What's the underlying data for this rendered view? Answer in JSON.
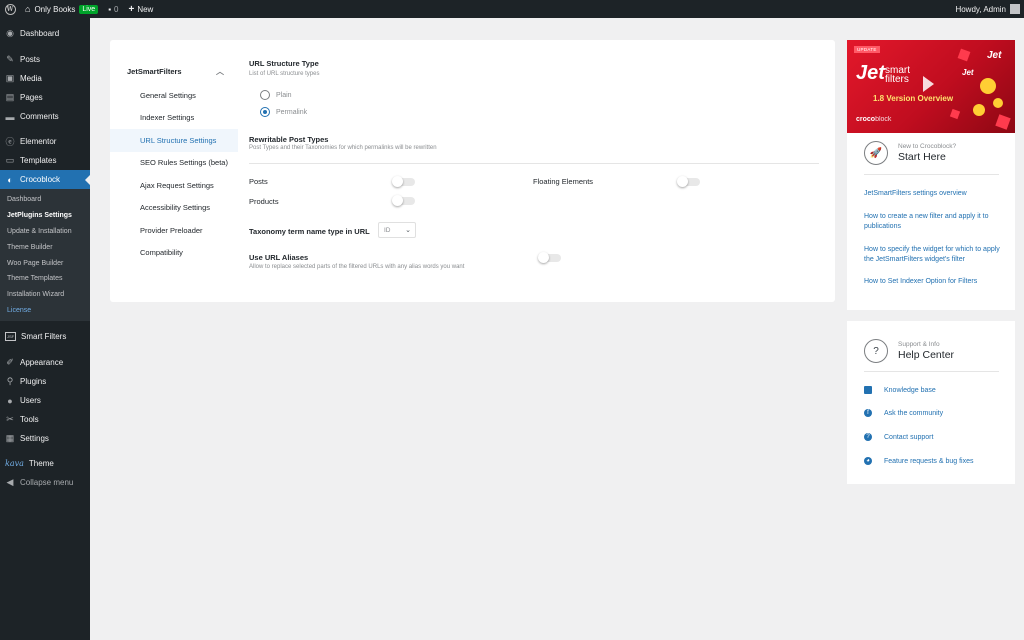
{
  "adminbar": {
    "site_name": "Only Books",
    "live_badge": "Live",
    "comments_count": "0",
    "new_label": "New",
    "greeting": "Howdy, Admin"
  },
  "sidebar": {
    "items_top": [
      {
        "label": "Dashboard",
        "icon": "dashboard-icon"
      },
      {
        "label": "Posts",
        "icon": "pin-icon"
      },
      {
        "label": "Media",
        "icon": "media-icon"
      },
      {
        "label": "Pages",
        "icon": "pages-icon"
      },
      {
        "label": "Comments",
        "icon": "comments-icon"
      },
      {
        "label": "Elementor",
        "icon": "elementor-icon"
      },
      {
        "label": "Templates",
        "icon": "folder-icon"
      },
      {
        "label": "Crocoblock",
        "icon": "crocoblock-icon"
      }
    ],
    "submenu": [
      "Dashboard",
      "JetPlugins Settings",
      "Update & Installation",
      "Theme Builder",
      "Woo Page Builder",
      "Theme Templates",
      "Installation Wizard",
      "License"
    ],
    "smart_filters": "Smart Filters",
    "items_bottom": [
      {
        "label": "Appearance",
        "icon": "appearance-icon"
      },
      {
        "label": "Plugins",
        "icon": "plugins-icon"
      },
      {
        "label": "Users",
        "icon": "users-icon"
      },
      {
        "label": "Tools",
        "icon": "tools-icon"
      },
      {
        "label": "Settings",
        "icon": "settings-icon"
      }
    ],
    "theme_logo": "kava",
    "theme_label": "Theme",
    "collapse_label": "Collapse menu"
  },
  "settings_nav": {
    "title": "JetSmartFilters",
    "items": [
      "General Settings",
      "Indexer Settings",
      "URL Structure Settings",
      "SEO Rules Settings (beta)",
      "Ajax Request Settings",
      "Accessibility Settings",
      "Provider Preloader",
      "Compatibility"
    ],
    "active_index": 2
  },
  "url_structure": {
    "title": "URL Structure Type",
    "desc": "List of URL structure types",
    "options": [
      "Plain",
      "Permalink"
    ],
    "selected": "Permalink"
  },
  "rewritable": {
    "title": "Rewritable Post Types",
    "desc": "Post Types and their Taxonomies for which permalinks will be rewritten",
    "posts_label": "Posts",
    "products_label": "Products",
    "floating_label": "Floating Elements"
  },
  "taxonomy": {
    "label": "Taxonomy term name type in URL",
    "value": "ID"
  },
  "aliases": {
    "title": "Use URL Aliases",
    "desc": "Allow to replace selected parts of the filtered URLs with any alias words you want"
  },
  "promo": {
    "badge": "UPDATE",
    "jet": "Jet",
    "smart": "smart",
    "filters": "filters",
    "version": "1.8 Version Overview",
    "croco": "croco",
    "block": "block",
    "new_to": "New to Crocoblock?",
    "start_here": "Start Here",
    "links": [
      "JetSmartFilters settings overview",
      "How to create a new filter and apply it to publications",
      "How to specify the widget for which to apply the JetSmartFilters widget's filter",
      "How to Set Indexer Option for Filters"
    ]
  },
  "help": {
    "small": "Support & Info",
    "big": "Help Center",
    "links": [
      {
        "label": "Knowledge base",
        "icon": "book-icon"
      },
      {
        "label": "Ask the community",
        "icon": "facebook-icon"
      },
      {
        "label": "Contact support",
        "icon": "question-icon"
      },
      {
        "label": "Feature requests & bug fixes",
        "icon": "github-icon"
      }
    ]
  },
  "colors": {
    "accent": "#2271b1",
    "sidebar_bg": "#1d2327",
    "live_green": "#00a32a",
    "banner_red": "#e3182b"
  }
}
